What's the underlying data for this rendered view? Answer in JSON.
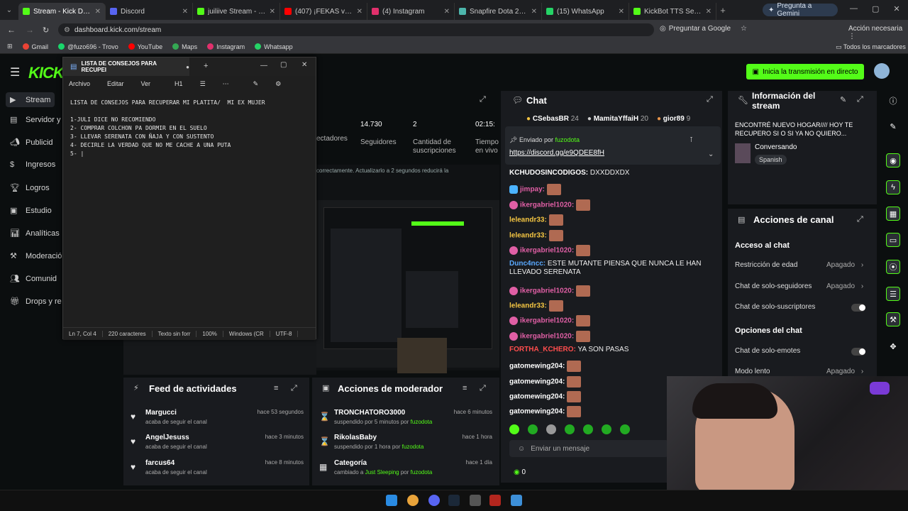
{
  "browser": {
    "tabs": [
      {
        "label": "Stream - Kick Dashbo",
        "color": "#53fc18",
        "active": true
      },
      {
        "label": "Discord",
        "color": "#5865f2"
      },
      {
        "label": "juiliive Stream - Watc",
        "color": "#53fc18"
      },
      {
        "label": "(407) ¡FEKAS vs AI",
        "color": "#ff0000"
      },
      {
        "label": "(4) Instagram",
        "color": "#e1306c"
      },
      {
        "label": "Snapfire Dota 2 Tatua",
        "color": "#4db6ac"
      },
      {
        "label": "(15) WhatsApp",
        "color": "#25d366"
      },
      {
        "label": "KickBot TTS Settings",
        "color": "#53fc18"
      }
    ],
    "gemini_label": "Pregunta a Gemini",
    "url": "dashboard.kick.com/stream",
    "google_label": "Preguntar a Google",
    "account_label": "Acción necesaria",
    "bookmarks": [
      {
        "label": "Gmail",
        "color": "#ea4335"
      },
      {
        "label": "@fuzo696 - Trovo",
        "color": "#19d66b"
      },
      {
        "label": "YouTube",
        "color": "#ff0000"
      },
      {
        "label": "Maps",
        "color": "#34a853"
      },
      {
        "label": "Instagram",
        "color": "#e1306c"
      },
      {
        "label": "Whatsapp",
        "color": "#25d366"
      }
    ],
    "all_bookmarks": "Todos los marcadores"
  },
  "kick": {
    "logo": "KICK",
    "go_live": "Inicia la transmisión en directo",
    "sidebar": [
      "Stream",
      "Servidor y c",
      "Publicid",
      "Ingresos",
      "Logros",
      "Estudio",
      "Analíticas",
      "Moderació",
      "Comunid",
      "Drops y re"
    ],
    "stats": {
      "partial_label": "ectadores",
      "followers_value": "14.730",
      "followers_label": "Seguidores",
      "subs_value": "2",
      "subs_label": "Cantidad de suscripciones",
      "time_value": "02:15:",
      "time_label": "Tiempo en vivo"
    },
    "preview_banner": "correctamente. Actualizarlo a 2 segundos reducirá la"
  },
  "notepad": {
    "tab_title": "LISTA DE CONSEJOS PARA RECUPEI",
    "menu": [
      "Archivo",
      "Editar",
      "Ver"
    ],
    "heading": "H1",
    "lines": [
      "LISTA DE CONSEJOS PARA RECUPERAR MI PLATITA/  MI EX MUJER",
      "",
      "1-JULI DICE NO RECOMIENDO",
      "2- COMPRAR COLCHON PA DORMIR EN EL SUELO",
      "3- LLEVAR SERENATA CON ÑAJA Y CON SUSTENTO",
      "4- DECIRLE LA VERDAD QUE NO ME CACHE A UNA PUTA",
      "5- |"
    ],
    "status": [
      "Ln 7, Col 4",
      "220 caracteres",
      "Texto sin forr",
      "100%",
      "Windows (CR",
      "UTF-8"
    ]
  },
  "chat": {
    "title": "Chat",
    "top_gifters": [
      {
        "name": "CSebasBR",
        "count": "24"
      },
      {
        "name": "MamitaYffaiH",
        "count": "20"
      },
      {
        "name": "gior89",
        "count": "9"
      }
    ],
    "pinned_by_label": "Enviado por",
    "pinned_by": "fuzodota",
    "pinned_link": "https://discord.gg/e9QDEE8fH",
    "messages": [
      {
        "user": "KCHUDOSINCODIGOS:",
        "color": "#ffffff",
        "text": "DXXDDXDX",
        "emote": false
      },
      {
        "user": "jimpay:",
        "color": "#e05fa5",
        "text": "",
        "emote": true,
        "badge": "sub"
      },
      {
        "user": "ikergabriel1020:",
        "color": "#e05fa5",
        "text": "",
        "emote": true,
        "badge": "pink"
      },
      {
        "user": "leleandr33:",
        "color": "#f4c542",
        "text": "",
        "emote": true
      },
      {
        "user": "leleandr33:",
        "color": "#f4c542",
        "text": "",
        "emote": true
      },
      {
        "user": "ikergabriel1020:",
        "color": "#e05fa5",
        "text": "",
        "emote": true,
        "badge": "pink"
      },
      {
        "user": "Dunc4ncc:",
        "color": "#5aa9ff",
        "text": "ESTE MUTANTE PIENSA QUE NUNCA LE HAN",
        "emote": false
      },
      {
        "user": "",
        "color": "#ffffff",
        "text": "LLEVADO SERENATA",
        "emote": false
      },
      {
        "user": "ikergabriel1020:",
        "color": "#e05fa5",
        "text": "",
        "emote": true,
        "badge": "pink"
      },
      {
        "user": "leleandr33:",
        "color": "#f4c542",
        "text": "",
        "emote": true
      },
      {
        "user": "ikergabriel1020:",
        "color": "#e05fa5",
        "text": "",
        "emote": true,
        "badge": "pink"
      },
      {
        "user": "ikergabriel1020:",
        "color": "#e05fa5",
        "text": "",
        "emote": true,
        "badge": "pink"
      },
      {
        "user": "FORTHA_KCHERO:",
        "color": "#ff4d4d",
        "text": "YA SON PASAS",
        "emote": false
      },
      {
        "user": "gatomewing204:",
        "color": "#ffffff",
        "text": "",
        "emote": true
      },
      {
        "user": "gatomewing204:",
        "color": "#ffffff",
        "text": "",
        "emote": true
      },
      {
        "user": "gatomewing204:",
        "color": "#ffffff",
        "text": "",
        "emote": true
      },
      {
        "user": "gatomewing204:",
        "color": "#ffffff",
        "text": "",
        "emote": true
      }
    ],
    "input_placeholder": "Enviar un mensaje",
    "points": "0"
  },
  "info": {
    "title": "Información del stream",
    "stream_title": "ENCONTRÉ NUEVO HOGAR//// HOY TE RECUPERO SI O SI YA NO QUIERO...",
    "category": "Conversando",
    "language": "Spanish"
  },
  "channel_actions": {
    "title": "Acciones de canal",
    "chat_access_heading": "Acceso al chat",
    "age_restriction": "Restricción de edad",
    "age_restriction_value": "Apagado",
    "followers_only": "Chat de solo-seguidores",
    "followers_only_value": "Apagado",
    "subs_only": "Chat de solo-suscriptores",
    "chat_options_heading": "Opciones del chat",
    "emotes_only": "Chat de solo-emotes",
    "slow_mode": "Modo lento",
    "slow_mode_value": "Apagado"
  },
  "feed": {
    "title": "Feed de actividades",
    "items": [
      {
        "name": "Margucci",
        "desc": "acaba de seguir el canal",
        "time": "hace 53 segundos"
      },
      {
        "name": "AngelJesuss",
        "desc": "acaba de seguir el canal",
        "time": "hace 3 minutos"
      },
      {
        "name": "farcus64",
        "desc": "acaba de seguir el canal",
        "time": "hace 8 minutos"
      }
    ]
  },
  "moderator": {
    "title": "Acciones de moderador",
    "items": [
      {
        "name": "TRONCHATORO3000",
        "desc": "suspendido por 5 minutos por",
        "by": "fuzodota",
        "time": "hace 6 minutos"
      },
      {
        "name": "RikolasBaby",
        "desc": "suspendido por 1 hora por",
        "by": "fuzodota",
        "time": "hace 1 hora"
      },
      {
        "name": "Categoría",
        "desc": "cambiado a",
        "cat": "Just Sleeping",
        "by_prefix": "por",
        "by": "fuzodota",
        "time": "hace 1 día"
      }
    ]
  },
  "colors": {
    "accent": "#53fc18",
    "panel": "#191b1f",
    "bg": "#0b0e0f"
  }
}
